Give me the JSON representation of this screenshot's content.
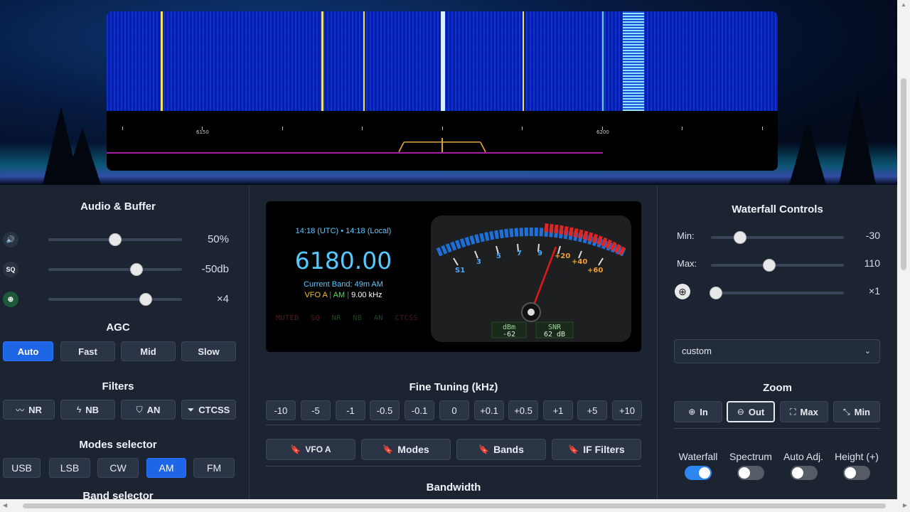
{
  "waterfall": {
    "tick_labels": [
      "6150",
      "6200"
    ],
    "colors": {
      "background": "#061bb0",
      "signal": "#f0e060",
      "passband": "#d9a033",
      "baseline": "#a51ba5"
    }
  },
  "audio_buffer": {
    "title": "Audio & Buffer",
    "sliders": [
      {
        "icon": "speaker-icon",
        "icon_text": "🔊",
        "value": "50%",
        "level": 0.5
      },
      {
        "icon": "squelch-icon",
        "icon_text": "SQ",
        "value": "-50db",
        "level": 0.66
      },
      {
        "icon": "buffer-icon",
        "icon_text": "⊕",
        "value": "×4",
        "level": 0.73
      }
    ]
  },
  "agc": {
    "title": "AGC",
    "buttons": [
      "Auto",
      "Fast",
      "Mid",
      "Slow"
    ],
    "active": "Auto"
  },
  "filters": {
    "title": "Filters",
    "buttons": [
      {
        "label": "NR",
        "icon": "〰"
      },
      {
        "label": "NB",
        "icon": "ϟ"
      },
      {
        "label": "AN",
        "icon": "⛉"
      },
      {
        "label": "CTCSS",
        "icon": "⏷"
      }
    ]
  },
  "modes": {
    "title": "Modes selector",
    "buttons": [
      "USB",
      "LSB",
      "CW",
      "AM",
      "FM"
    ],
    "active": "AM"
  },
  "band_selector": {
    "title": "Band selector"
  },
  "display": {
    "time": "14:18 (UTC) • 14:18 (Local)",
    "frequency": "6180.00",
    "band": "Current Band: 49m AM",
    "vfo": "VFO A",
    "mode": "AM",
    "step": "9.00 kHz",
    "status_flags": [
      "MUTED",
      "SQ",
      "NR",
      "NB",
      "AN",
      "CTCSS"
    ],
    "meter": {
      "scale_labels": [
        "S1",
        "3",
        "5",
        "7",
        "9",
        "+20",
        "+40",
        "+60"
      ],
      "dbm_label": "dBm",
      "dbm_value": "-62",
      "snr_label": "SNR",
      "snr_value": "62 dB"
    }
  },
  "fine_tuning": {
    "title": "Fine Tuning (kHz)",
    "steps": [
      "-10",
      "-5",
      "-1",
      "-0.5",
      "-0.1",
      "0",
      "+0.1",
      "+0.5",
      "+1",
      "+5",
      "+10"
    ]
  },
  "bookmarks": {
    "buttons": [
      "VFO A",
      "Modes",
      "Bands",
      "IF Filters"
    ]
  },
  "bandwidth": {
    "title": "Bandwidth"
  },
  "waterfall_controls": {
    "title": "Waterfall Controls",
    "min_label": "Min:",
    "min_value": "-30",
    "min_level": 0.22,
    "max_label": "Max:",
    "max_value": "110",
    "max_level": 0.44,
    "zoom_value": "×1",
    "zoom_level": 0.04,
    "colormap": "custom"
  },
  "zoom": {
    "title": "Zoom",
    "buttons": [
      {
        "label": "In",
        "icon": "⊕"
      },
      {
        "label": "Out",
        "icon": "⊖"
      },
      {
        "label": "Max",
        "icon": "⛶"
      },
      {
        "label": "Min",
        "icon": "⤡"
      }
    ],
    "active": "Out"
  },
  "toggles": [
    {
      "label": "Waterfall",
      "on": true
    },
    {
      "label": "Spectrum",
      "on": false
    },
    {
      "label": "Auto Adj.",
      "on": false
    },
    {
      "label": "Height (+)",
      "on": false
    }
  ]
}
